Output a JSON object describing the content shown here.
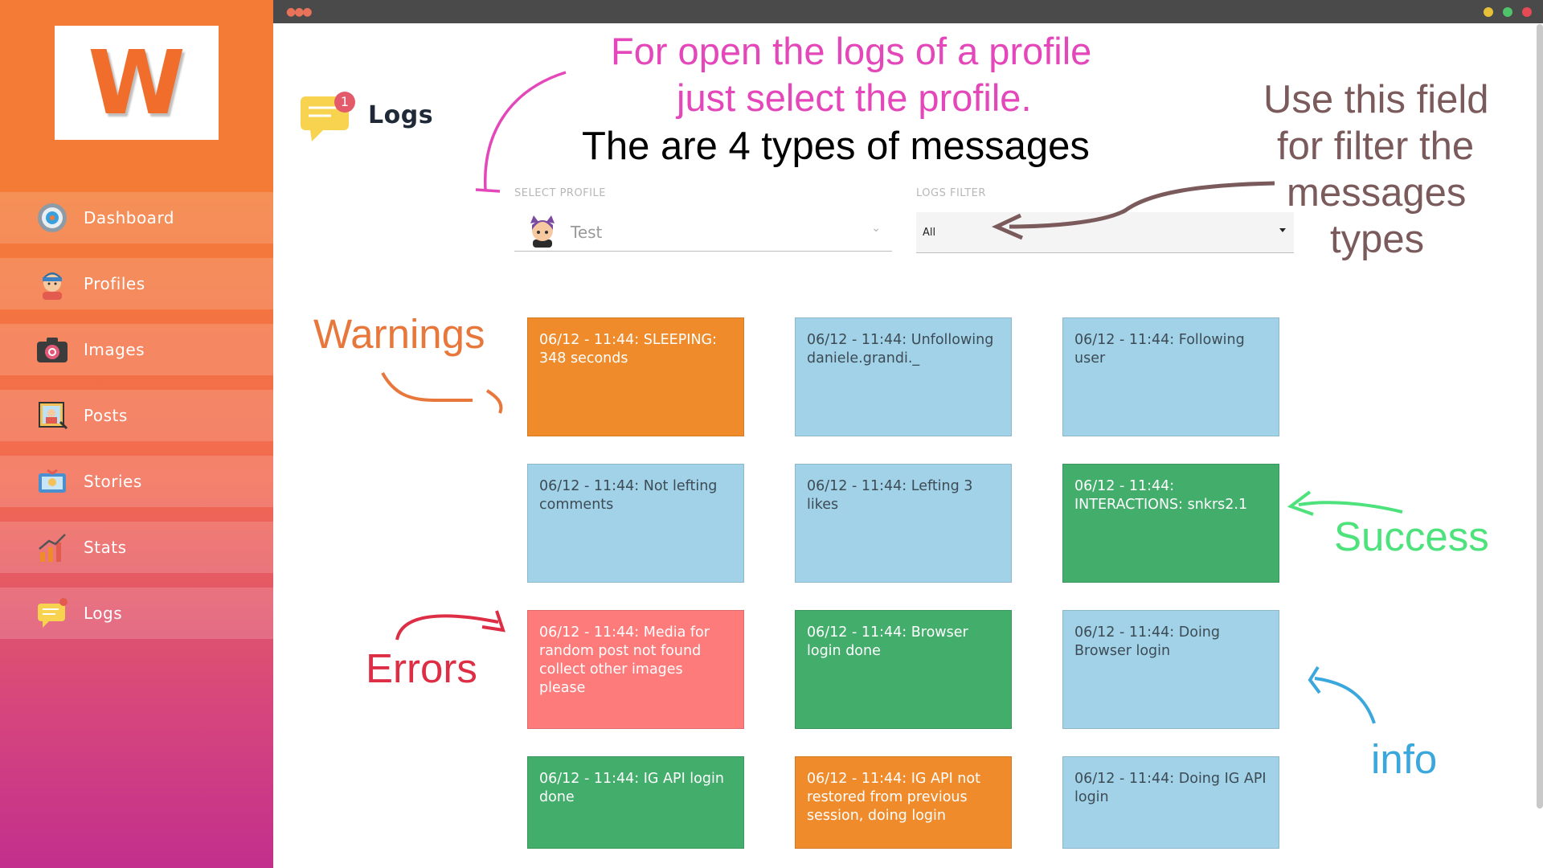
{
  "sidebar": {
    "logo_letter": "W",
    "items": [
      {
        "label": "Dashboard",
        "icon": "dashboard-gauge-icon"
      },
      {
        "label": "Profiles",
        "icon": "profile-avatar-icon"
      },
      {
        "label": "Images",
        "icon": "camera-icon"
      },
      {
        "label": "Posts",
        "icon": "post-picture-icon"
      },
      {
        "label": "Stories",
        "icon": "stories-icon"
      },
      {
        "label": "Stats",
        "icon": "stats-chart-icon"
      },
      {
        "label": "Logs",
        "icon": "logs-chat-icon"
      }
    ]
  },
  "header": {
    "title": "Logs",
    "badge_count": "1",
    "icon": "logs-chat-icon"
  },
  "profile_select": {
    "label": "SELECT PROFILE",
    "value": "Test",
    "icon": "profile-avatar-icon"
  },
  "logs_filter": {
    "label": "LOGS FILTER",
    "value": "All"
  },
  "log_cards": [
    {
      "type": "warning",
      "text": "06/12 - 11:44: SLEEPING: 348 seconds"
    },
    {
      "type": "info",
      "text": "06/12 - 11:44: Unfollowing daniele.grandi._"
    },
    {
      "type": "info",
      "text": "06/12 - 11:44: Following user"
    },
    {
      "type": "info",
      "text": "06/12 - 11:44: Not lefting comments"
    },
    {
      "type": "info",
      "text": "06/12 - 11:44: Lefting 3 likes"
    },
    {
      "type": "success",
      "text": "06/12 - 11:44: INTERACTIONS: snkrs2.1"
    },
    {
      "type": "error",
      "text": "06/12 - 11:44: Media for random post not found collect other images please"
    },
    {
      "type": "success",
      "text": "06/12 - 11:44: Browser login done"
    },
    {
      "type": "info",
      "text": "06/12 - 11:44: Doing Browser login"
    },
    {
      "type": "success",
      "text": "06/12 - 11:44: IG API login done"
    },
    {
      "type": "warning",
      "text": "06/12 - 11:44: IG API not restored from previous session, doing login"
    },
    {
      "type": "info",
      "text": "06/12 - 11:44: Doing IG API login"
    }
  ],
  "annotations": {
    "open_logs_line1": "For open the logs of a profile",
    "open_logs_line2": "just select the profile.",
    "types_note": "The are 4 types of messages",
    "filter_note_line1": "Use this field",
    "filter_note_line2": "for filter the",
    "filter_note_line3": "messages",
    "filter_note_line4": "types",
    "warnings": "Warnings",
    "success": "Success",
    "errors": "Errors",
    "info": "info"
  },
  "colors": {
    "info": "#a1d2e8",
    "warning": "#f08b2c",
    "success": "#43ad6b",
    "error": "#fe7b7b",
    "brand": "#f47b36",
    "annot_pink": "#e447b9",
    "annot_brown": "#7b5a5c",
    "annot_orange": "#e8773c",
    "annot_green": "#4ee27d",
    "annot_red": "#dd2e45",
    "annot_blue": "#3aa7dd"
  }
}
